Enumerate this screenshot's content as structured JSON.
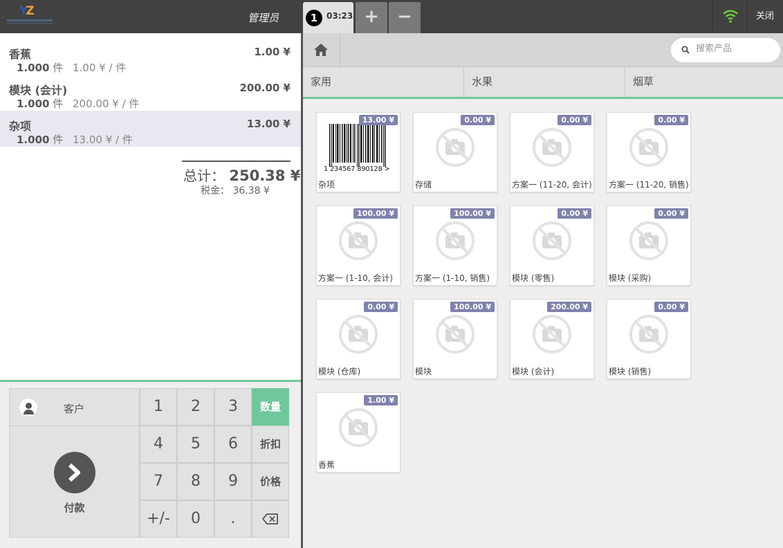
{
  "header": {
    "user": "管理员",
    "order_number": "1",
    "order_time": "03:23",
    "add_label": "+",
    "remove_label": "−",
    "close_label": "关闭"
  },
  "order": {
    "lines": [
      {
        "name": "香蕉",
        "price": "1.00 ¥",
        "qty": "1.000",
        "qty_unit": "件",
        "unit_price": "1.00 ¥ / 件"
      },
      {
        "name": "模块 (会计)",
        "price": "200.00 ¥",
        "qty": "1.000",
        "qty_unit": "件",
        "unit_price": "200.00 ¥ / 件"
      },
      {
        "name": "杂项",
        "price": "13.00 ¥",
        "qty": "1.000",
        "qty_unit": "件",
        "unit_price": "13.00 ¥ / 件"
      }
    ],
    "total_label": "总计：",
    "total_value": "250.38 ¥",
    "tax_label": "税金：",
    "tax_value": "36.38 ¥"
  },
  "pad": {
    "customer_label": "客户",
    "payment_label": "付款",
    "keys": [
      "1",
      "2",
      "3",
      "4",
      "5",
      "6",
      "7",
      "8",
      "9",
      "+/-",
      "0",
      "."
    ],
    "modes": [
      "数量",
      "折扣",
      "价格"
    ],
    "active_mode": "数量"
  },
  "products_panel": {
    "search_placeholder": "搜索产品",
    "categories": [
      "家用",
      "水果",
      "烟草"
    ],
    "products": [
      {
        "name": "杂项",
        "price": "13.00 ¥",
        "image": "barcode"
      },
      {
        "name": "存储",
        "price": "0.00 ¥",
        "image": "no-image"
      },
      {
        "name": "方案一 (11-20, 会计)",
        "price": "0.00 ¥",
        "image": "no-image"
      },
      {
        "name": "方案一 (11-20, 销售)",
        "price": "0.00 ¥",
        "image": "no-image"
      },
      {
        "name": "方案一 (1-10, 会计)",
        "price": "100.00 ¥",
        "image": "no-image"
      },
      {
        "name": "方案一 (1-10, 销售)",
        "price": "100.00 ¥",
        "image": "no-image"
      },
      {
        "name": "模块 (零售)",
        "price": "0.00 ¥",
        "image": "no-image"
      },
      {
        "name": "模块 (采购)",
        "price": "0.00 ¥",
        "image": "no-image"
      },
      {
        "name": "模块 (仓库)",
        "price": "0.00 ¥",
        "image": "no-image"
      },
      {
        "name": "模块",
        "price": "100.00 ¥",
        "image": "no-image"
      },
      {
        "name": "模块 (会计)",
        "price": "200.00 ¥",
        "image": "no-image"
      },
      {
        "name": "模块 (销售)",
        "price": "0.00 ¥",
        "image": "no-image"
      },
      {
        "name": "香蕉",
        "price": "1.00 ¥",
        "image": "no-image"
      }
    ],
    "barcode_digits": "1 234567 890128 >"
  },
  "colors": {
    "accent": "#6ec89b",
    "badge": "#7f82ac",
    "topbar": "#414141",
    "wifi": "#6ec83c"
  }
}
